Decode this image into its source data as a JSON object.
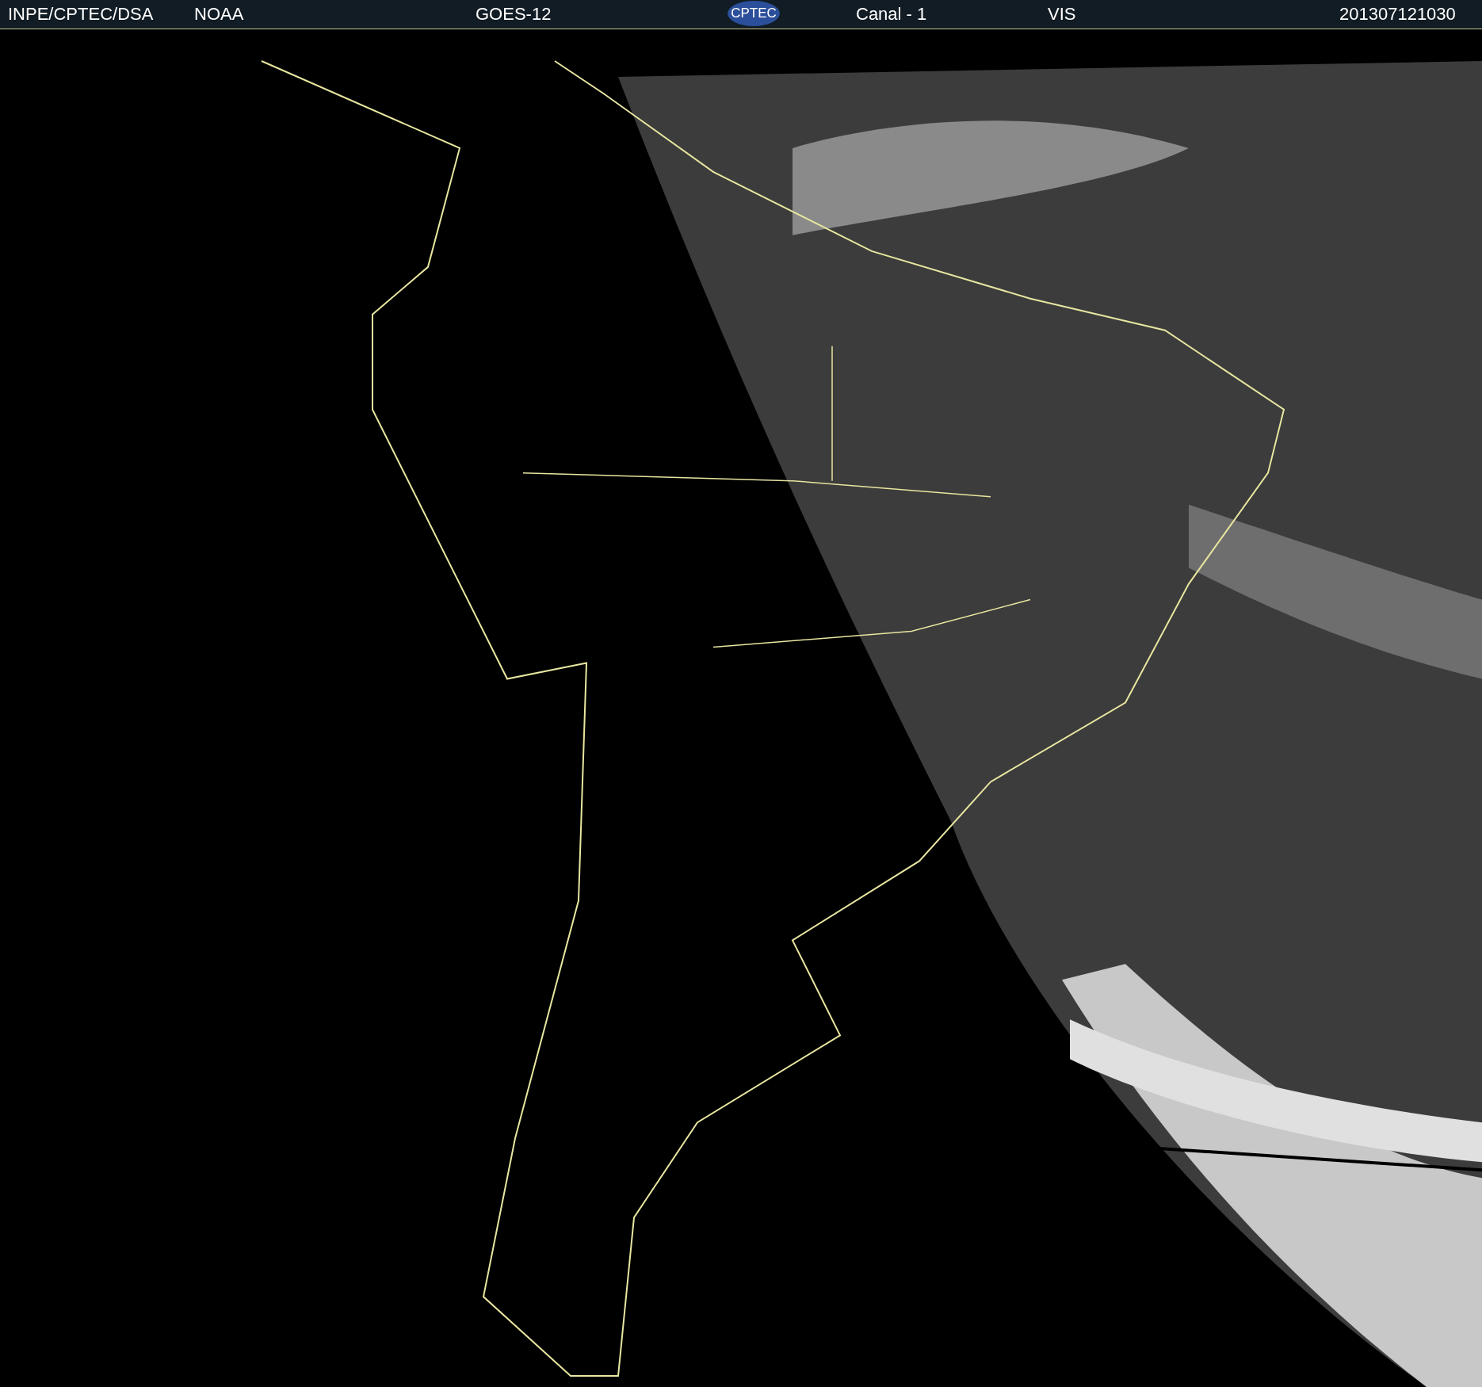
{
  "header": {
    "items": [
      {
        "kind": "text",
        "text": "INPE/CPTEC/DSA"
      },
      {
        "kind": "text",
        "text": "NOAA"
      },
      {
        "kind": "text",
        "text": "GOES-12"
      },
      {
        "kind": "logo",
        "text": "CPTEC"
      },
      {
        "kind": "text",
        "text": "Canal - 1"
      },
      {
        "kind": "text",
        "text": "VIS"
      },
      {
        "kind": "text",
        "text": "201307121030"
      }
    ]
  }
}
